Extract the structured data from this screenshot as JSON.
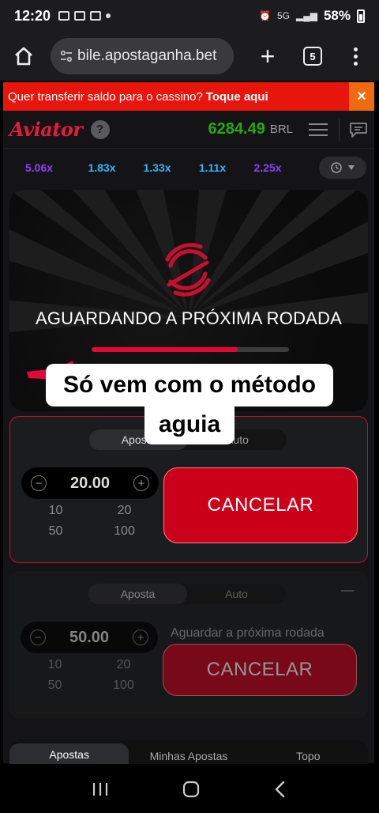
{
  "status_bar": {
    "time": "12:20",
    "network": "5G",
    "battery": "58%"
  },
  "browser": {
    "url": "bile.apostaganha.bet",
    "tab_count": "5"
  },
  "banner": {
    "text": "Quer transferir saldo para o cassino?",
    "link": "Toque aqui",
    "close": "×"
  },
  "game": {
    "logo": "Aviator",
    "help": "?",
    "balance": "6284.49",
    "currency": "BRL",
    "multipliers": [
      {
        "value": "5.06x",
        "color": "#913ef8"
      },
      {
        "value": "1.83x",
        "color": "#34b4ff"
      },
      {
        "value": "1.33x",
        "color": "#34b4ff"
      },
      {
        "value": "1.11x",
        "color": "#34b4ff"
      },
      {
        "value": "2.25x",
        "color": "#913ef8"
      }
    ],
    "waiting_text": "AGUARDANDO A PRÓXIMA RODADA",
    "progress": 0.74
  },
  "caption": {
    "line1": "Só vem com o método",
    "line2": "aguia"
  },
  "bet1": {
    "tab_bet": "Aposta",
    "tab_auto": "Auto",
    "amount": "20.00",
    "quick": [
      "10",
      "20",
      "50",
      "100"
    ],
    "button": "CANCELAR"
  },
  "bet2": {
    "tab_bet": "Aposta",
    "tab_auto": "Auto",
    "amount": "50.00",
    "quick": [
      "10",
      "20",
      "50",
      "100"
    ],
    "waiting": "Aguardar a próxima rodada",
    "button": "CANCELAR"
  },
  "bottom_tabs": [
    "Apostas",
    "Minhas Apostas",
    "Topo"
  ],
  "colors": {
    "accent_red": "#e41b3c",
    "balance_green": "#28a909",
    "banner_red": "#e8150d"
  }
}
